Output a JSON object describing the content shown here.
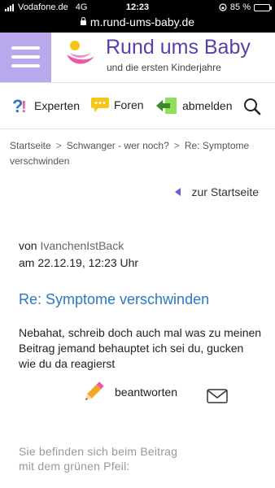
{
  "status": {
    "carrier": "Vodafone.de",
    "network": "4G",
    "time": "12:23",
    "battery": "85 %",
    "battery_level": 0.85,
    "url": "m.rund-ums-baby.de"
  },
  "header": {
    "title": "Rund ums Baby",
    "subtitle": "und die ersten Kinderjahre"
  },
  "nav": {
    "experts": "Experten",
    "forums": "Foren",
    "logout": "abmelden"
  },
  "breadcrumb": {
    "home": "Startseite",
    "forum": "Schwanger - wer noch?",
    "current": "Re: Symptome verschwinden"
  },
  "back_link": "zur Startseite",
  "post": {
    "by_label": "von",
    "author": "IvanchenIstBack",
    "date": "am 22.12.19, 12:23 Uhr",
    "title": "Re: Symptome verschwinden",
    "body": "Nebahat, schreib doch auch mal was zu meinen Beitrag jemand behauptet ich sei du, gucken wie du da reagierst",
    "reply_label": "beantworten"
  },
  "footer_note": {
    "line1": "Sie befinden sich beim Beitrag",
    "line2": "mit dem grünen Pfeil:"
  },
  "colors": {
    "menu_bg": "#b9a8ec",
    "brand": "#5a3fa8",
    "link_blue": "#2b78c2",
    "forum_yellow": "#f5c518",
    "logout_green": "#6cc04a"
  }
}
